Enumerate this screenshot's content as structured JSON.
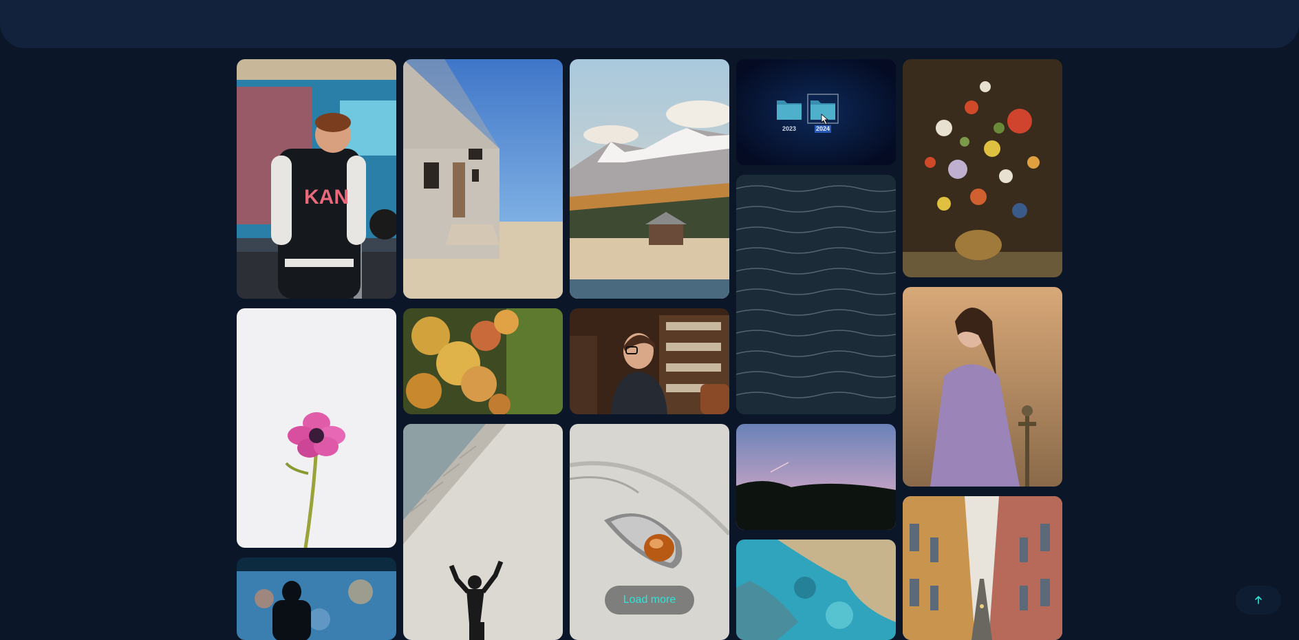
{
  "load_more": {
    "label": "Load more"
  },
  "scroll_top": {
    "icon": "arrow-up-icon"
  },
  "folder_tile": {
    "labels": [
      "2023",
      "2024"
    ]
  },
  "jacket_text": "KAN",
  "colors": {
    "accent": "#2ee5d6",
    "background": "#0b1628",
    "header": "#13223c"
  }
}
